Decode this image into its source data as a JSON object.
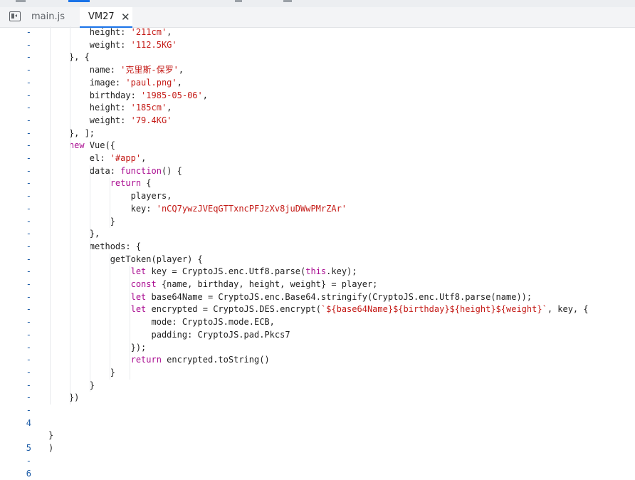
{
  "tabs": {
    "first": "main.js",
    "active": "VM27",
    "active_close": "✕"
  },
  "gutter": [
    "-",
    "-",
    "-",
    "-",
    "-",
    "-",
    "-",
    "-",
    "-",
    "-",
    "-",
    "-",
    "-",
    "-",
    "-",
    "-",
    "-",
    "-",
    "-",
    "-",
    "-",
    "-",
    "-",
    "-",
    "-",
    "-",
    "-",
    "-",
    "-",
    "-",
    "-",
    "4",
    "",
    "5",
    "-",
    "6"
  ],
  "lines": [
    [
      {
        "t": "        height: ",
        "c": "n"
      },
      {
        "t": "'211cm'",
        "c": "s"
      },
      {
        "t": ",",
        "c": "n"
      }
    ],
    [
      {
        "t": "        weight: ",
        "c": "n"
      },
      {
        "t": "'112.5KG'",
        "c": "s"
      }
    ],
    [
      {
        "t": "    }, {",
        "c": "n"
      }
    ],
    [
      {
        "t": "        name: ",
        "c": "n"
      },
      {
        "t": "'克里斯-保罗'",
        "c": "s"
      },
      {
        "t": ",",
        "c": "n"
      }
    ],
    [
      {
        "t": "        image: ",
        "c": "n"
      },
      {
        "t": "'paul.png'",
        "c": "s"
      },
      {
        "t": ",",
        "c": "n"
      }
    ],
    [
      {
        "t": "        birthday: ",
        "c": "n"
      },
      {
        "t": "'1985-05-06'",
        "c": "s"
      },
      {
        "t": ",",
        "c": "n"
      }
    ],
    [
      {
        "t": "        height: ",
        "c": "n"
      },
      {
        "t": "'185cm'",
        "c": "s"
      },
      {
        "t": ",",
        "c": "n"
      }
    ],
    [
      {
        "t": "        weight: ",
        "c": "n"
      },
      {
        "t": "'79.4KG'",
        "c": "s"
      }
    ],
    [
      {
        "t": "    }, ];",
        "c": "n"
      }
    ],
    [
      {
        "t": "    ",
        "c": "n"
      },
      {
        "t": "new",
        "c": "k"
      },
      {
        "t": " Vue({",
        "c": "n"
      }
    ],
    [
      {
        "t": "        el: ",
        "c": "n"
      },
      {
        "t": "'#app'",
        "c": "s"
      },
      {
        "t": ",",
        "c": "n"
      }
    ],
    [
      {
        "t": "        data: ",
        "c": "n"
      },
      {
        "t": "function",
        "c": "k"
      },
      {
        "t": "() {",
        "c": "n"
      }
    ],
    [
      {
        "t": "            ",
        "c": "n"
      },
      {
        "t": "return",
        "c": "k"
      },
      {
        "t": " {",
        "c": "n"
      }
    ],
    [
      {
        "t": "                players,",
        "c": "n"
      }
    ],
    [
      {
        "t": "                key: ",
        "c": "n"
      },
      {
        "t": "'nCQ7ywzJVEqGTTxncPFJzXv8juDWwPMrZAr'",
        "c": "s"
      }
    ],
    [
      {
        "t": "            }",
        "c": "n"
      }
    ],
    [
      {
        "t": "        },",
        "c": "n"
      }
    ],
    [
      {
        "t": "        methods: {",
        "c": "n"
      }
    ],
    [
      {
        "t": "            getToken(player) {",
        "c": "n"
      }
    ],
    [
      {
        "t": "                ",
        "c": "n"
      },
      {
        "t": "let",
        "c": "k"
      },
      {
        "t": " key = CryptoJS.enc.Utf8.parse(",
        "c": "n"
      },
      {
        "t": "this",
        "c": "k"
      },
      {
        "t": ".key);",
        "c": "n"
      }
    ],
    [
      {
        "t": "                ",
        "c": "n"
      },
      {
        "t": "const",
        "c": "k"
      },
      {
        "t": " {name, birthday, height, weight} = player;",
        "c": "n"
      }
    ],
    [
      {
        "t": "                ",
        "c": "n"
      },
      {
        "t": "let",
        "c": "k"
      },
      {
        "t": " base64Name = CryptoJS.enc.Base64.stringify(CryptoJS.enc.Utf8.parse(name));",
        "c": "n"
      }
    ],
    [
      {
        "t": "                ",
        "c": "n"
      },
      {
        "t": "let",
        "c": "k"
      },
      {
        "t": " encrypted = CryptoJS.DES.encrypt(",
        "c": "n"
      },
      {
        "t": "`${base64Name}${birthday}${height}${weight}`",
        "c": "s"
      },
      {
        "t": ", key, {",
        "c": "n"
      }
    ],
    [
      {
        "t": "                    mode: CryptoJS.mode.ECB,",
        "c": "n"
      }
    ],
    [
      {
        "t": "                    padding: CryptoJS.pad.Pkcs7",
        "c": "n"
      }
    ],
    [
      {
        "t": "                });",
        "c": "n"
      }
    ],
    [
      {
        "t": "                ",
        "c": "n"
      },
      {
        "t": "return",
        "c": "k"
      },
      {
        "t": " encrypted.toString()",
        "c": "n"
      }
    ],
    [
      {
        "t": "            }",
        "c": "n"
      }
    ],
    [
      {
        "t": "        }",
        "c": "n"
      }
    ],
    [
      {
        "t": "    })",
        "c": "n"
      }
    ],
    [],
    [],
    [
      {
        "t": "}",
        "c": "n"
      }
    ],
    [
      {
        "t": ")",
        "c": "n"
      }
    ],
    [],
    []
  ],
  "colors": {
    "keyword": "#aa0d91",
    "string": "#c41a16",
    "line_number": "#1a5aa6",
    "accent": "#1a73e8"
  }
}
